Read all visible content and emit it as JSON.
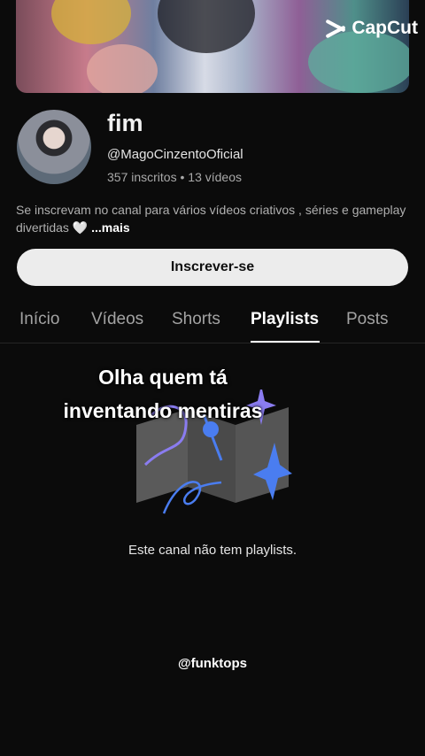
{
  "watermark_app": "CapCut",
  "channel": {
    "name": "fim",
    "handle": "@MagoCinzentoOficial",
    "subscribers": "357 inscritos",
    "separator": "•",
    "videos": "13 vídeos",
    "description": "Se inscrevam no canal para vários vídeos criativos , séries e gameplay divertidas 🤍",
    "more_label": "...mais"
  },
  "subscribe_label": "Inscrever-se",
  "tabs": [
    {
      "label": "Início"
    },
    {
      "label": "Vídeos"
    },
    {
      "label": "Shorts"
    },
    {
      "label": "Playlists",
      "active": true
    },
    {
      "label": "Posts"
    }
  ],
  "overlay_caption": {
    "line1": "Olha quem tá",
    "line2": "inventando mentiras"
  },
  "empty_state": "Este canal não tem playlists.",
  "credit": "@funktops",
  "colors": {
    "background": "#0b0b0b",
    "subscribe_button": "#ececec",
    "illustration_purple": "#8a7cf0",
    "illustration_blue": "#4a7df0"
  }
}
